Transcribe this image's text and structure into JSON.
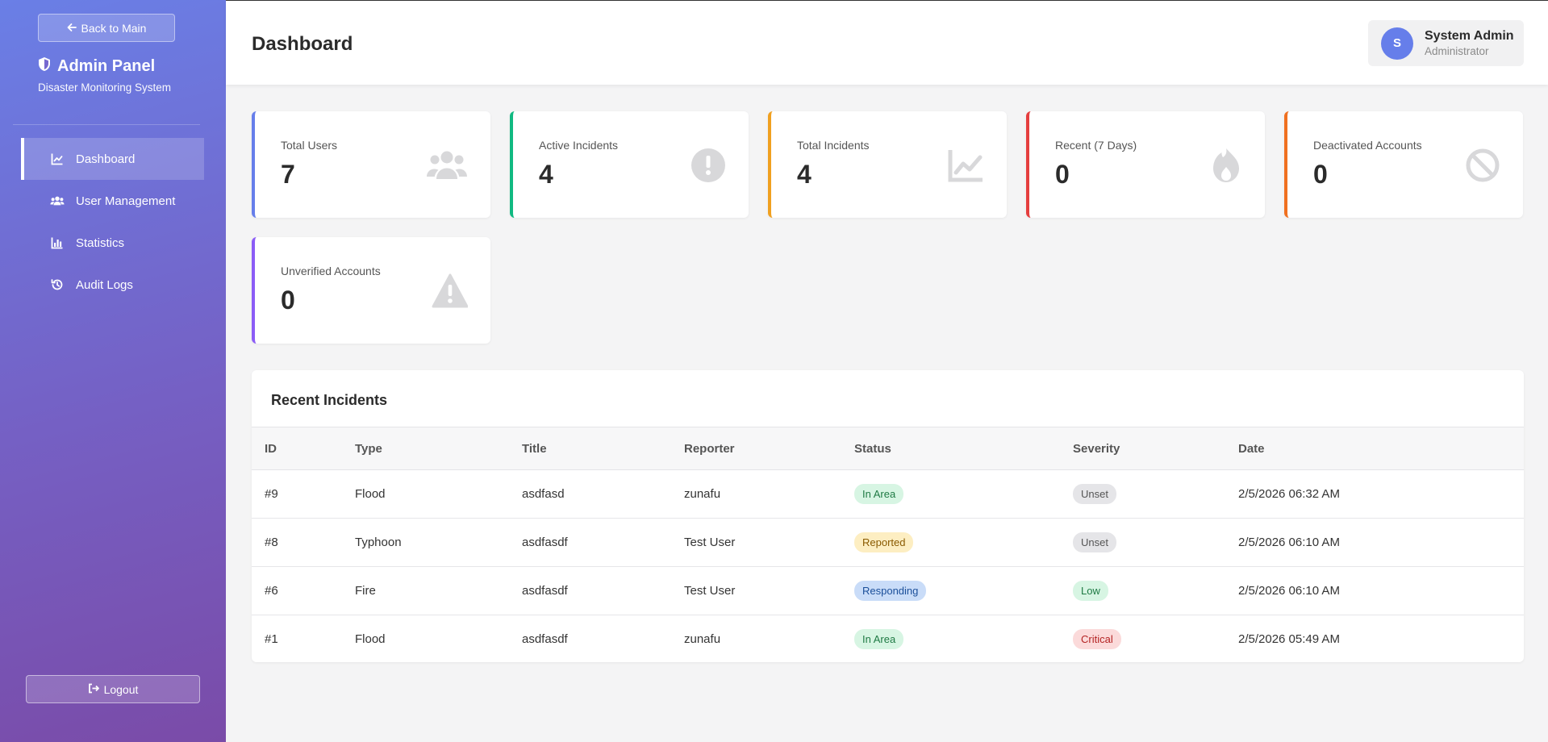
{
  "sidebar": {
    "back_label": "Back to Main",
    "brand_title": "Admin Panel",
    "brand_subtitle": "Disaster Monitoring System",
    "items": [
      {
        "label": "Dashboard",
        "icon": "chart-line-icon",
        "active": true
      },
      {
        "label": "User Management",
        "icon": "users-icon",
        "active": false
      },
      {
        "label": "Statistics",
        "icon": "bar-chart-icon",
        "active": false
      },
      {
        "label": "Audit Logs",
        "icon": "history-icon",
        "active": false
      }
    ],
    "logout_label": "Logout"
  },
  "header": {
    "title": "Dashboard",
    "user": {
      "initial": "S",
      "name": "System Admin",
      "role": "Administrator"
    }
  },
  "stats": [
    {
      "label": "Total Users",
      "value": "7",
      "icon": "users-icon",
      "accent": "#667eea"
    },
    {
      "label": "Active Incidents",
      "value": "4",
      "icon": "exclamation-circle-icon",
      "accent": "#10b981"
    },
    {
      "label": "Total Incidents",
      "value": "4",
      "icon": "chart-line-icon",
      "accent": "#f0a020"
    },
    {
      "label": "Recent (7 Days)",
      "value": "0",
      "icon": "fire-icon",
      "accent": "#e53e3e"
    },
    {
      "label": "Deactivated Accounts",
      "value": "0",
      "icon": "ban-icon",
      "accent": "#f07020"
    },
    {
      "label": "Unverified Accounts",
      "value": "0",
      "icon": "warning-triangle-icon",
      "accent": "#8b5cf6"
    }
  ],
  "incidents": {
    "title": "Recent Incidents",
    "columns": [
      "ID",
      "Type",
      "Title",
      "Reporter",
      "Status",
      "Severity",
      "Date"
    ],
    "rows": [
      {
        "id": "#9",
        "type": "Flood",
        "title": "asdfasd",
        "reporter": "zunafu",
        "status": "In Area",
        "severity": "Unset",
        "date": "2/5/2026 06:32 AM"
      },
      {
        "id": "#8",
        "type": "Typhoon",
        "title": "asdfasdf",
        "reporter": "Test User",
        "status": "Reported",
        "severity": "Unset",
        "date": "2/5/2026 06:10 AM"
      },
      {
        "id": "#6",
        "type": "Fire",
        "title": "asdfasdf",
        "reporter": "Test User",
        "status": "Responding",
        "severity": "Low",
        "date": "2/5/2026 06:10 AM"
      },
      {
        "id": "#1",
        "type": "Flood",
        "title": "asdfasdf",
        "reporter": "zunafu",
        "status": "In Area",
        "severity": "Critical",
        "date": "2/5/2026 05:49 AM"
      }
    ]
  },
  "colors": {
    "primary": "#667eea",
    "sidebar_gradient_start": "#6a7fe6",
    "sidebar_gradient_end": "#7a4ba8"
  }
}
